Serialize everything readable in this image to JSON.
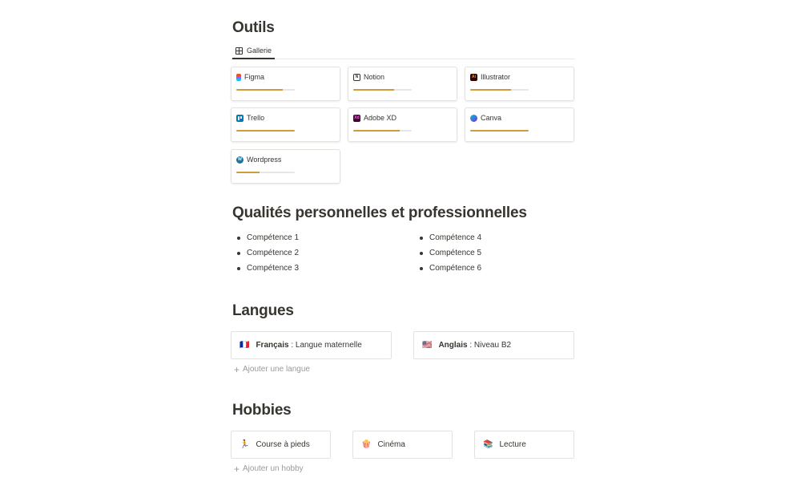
{
  "outils": {
    "title": "Outils",
    "view_tab": "Gallerie",
    "tools": [
      {
        "name": "Figma",
        "logo": "figma-logo",
        "level": 0.8
      },
      {
        "name": "Notion",
        "logo": "notion-logo",
        "level": 0.7
      },
      {
        "name": "Illustrator",
        "logo": "illustrator-logo",
        "logo_text": "Ai",
        "level": 0.7
      },
      {
        "name": "Trello",
        "logo": "trello-logo",
        "level": 1.0
      },
      {
        "name": "Adobe XD",
        "logo": "adobe-xd-logo",
        "logo_text": "Xd",
        "level": 0.8
      },
      {
        "name": "Canva",
        "logo": "canva-logo",
        "level": 1.0
      },
      {
        "name": "Wordpress",
        "logo": "wordpress-logo",
        "level": 0.4
      }
    ],
    "colors": {
      "progress": "#d49a3a",
      "track": "#e6e6e4"
    }
  },
  "qualites": {
    "title": "Qualités personnelles et professionnelles",
    "items": [
      "Compétence 1",
      "Compétence 2",
      "Compétence 3",
      "Compétence 4",
      "Compétence 5",
      "Compétence 6"
    ]
  },
  "langues": {
    "title": "Langues",
    "items": [
      {
        "flag": "🇫🇷",
        "name": "Français",
        "detail": " : Langue maternelle"
      },
      {
        "flag": "🇺🇸",
        "name": "Anglais",
        "detail": " : Niveau B2"
      }
    ],
    "add_label": "Ajouter une langue"
  },
  "hobbies": {
    "title": "Hobbies",
    "items": [
      {
        "emoji": "🏃",
        "label": "Course à pieds"
      },
      {
        "emoji": "🍿",
        "label": "Cinéma"
      },
      {
        "emoji": "📚",
        "label": "Lecture"
      }
    ],
    "add_label": "Ajouter un hobby"
  }
}
